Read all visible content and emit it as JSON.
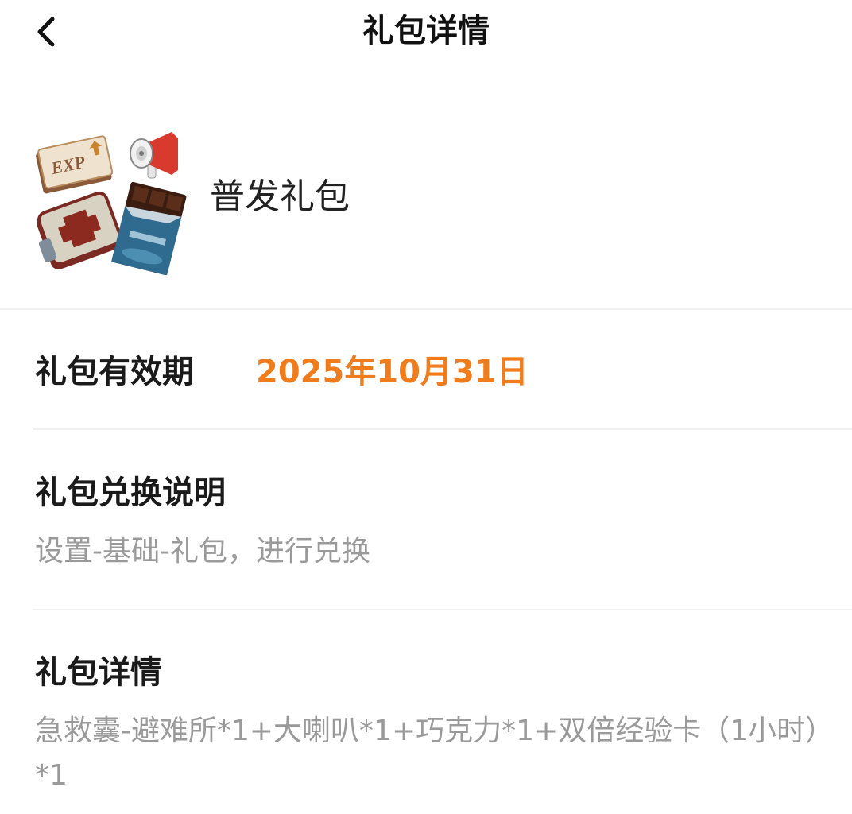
{
  "header": {
    "title": "礼包详情",
    "back_icon": "chevron-left-icon"
  },
  "gift": {
    "name": "普发礼包",
    "image_icon": "gift-items-image"
  },
  "validity": {
    "label": "礼包有效期",
    "value": "2025年10月31日",
    "value_color": "#f07c1c"
  },
  "redeem": {
    "title": "礼包兑换说明",
    "text": "设置-基础-礼包，进行兑换"
  },
  "details": {
    "title": "礼包详情",
    "text": "急救囊-避难所*1+大喇叭*1+巧克力*1+双倍经验卡（1小时）*1"
  }
}
